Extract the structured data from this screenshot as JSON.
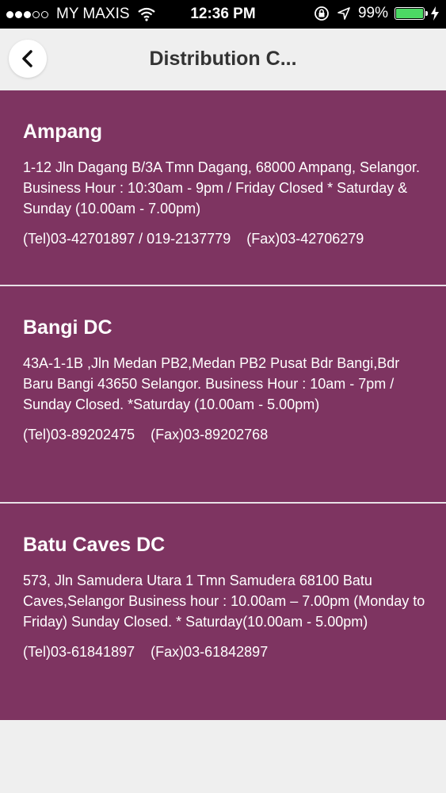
{
  "status_bar": {
    "carrier": "MY MAXIS",
    "time": "12:36 PM",
    "battery": "99%",
    "battery_level": 0.99,
    "battery_color": "#4cd964"
  },
  "nav": {
    "title": "Distribution C...",
    "back_icon": "chevron-left-icon"
  },
  "theme": {
    "card_color": "#7e3461",
    "background": "#efefef"
  },
  "centers": [
    {
      "name": "Ampang",
      "address": "1-12 Jln Dagang B/3A Tmn Dagang, 68000 Ampang, Selangor. Business Hour : 10:30am - 9pm / Friday Closed * Saturday & Sunday (10.00am - 7.00pm)",
      "tel": "(Tel)03-42701897 / 019-2137779",
      "fax": "(Fax)03-42706279"
    },
    {
      "name": "Bangi DC",
      "address": "43A-1-1B ,Jln Medan PB2,Medan PB2 Pusat Bdr Bangi,Bdr Baru Bangi 43650 Selangor. Business Hour : 10am - 7pm / Sunday Closed. *Saturday (10.00am - 5.00pm)",
      "tel": "(Tel)03-89202475",
      "fax": "(Fax)03-89202768"
    },
    {
      "name": "Batu Caves DC",
      "address": "573, Jln Samudera Utara 1 Tmn Samudera 68100 Batu Caves,Selangor Business hour : 10.00am – 7.00pm (Monday to Friday) Sunday Closed. * Saturday(10.00am - 5.00pm)",
      "tel": "(Tel)03-61841897",
      "fax": "(Fax)03-61842897"
    }
  ]
}
